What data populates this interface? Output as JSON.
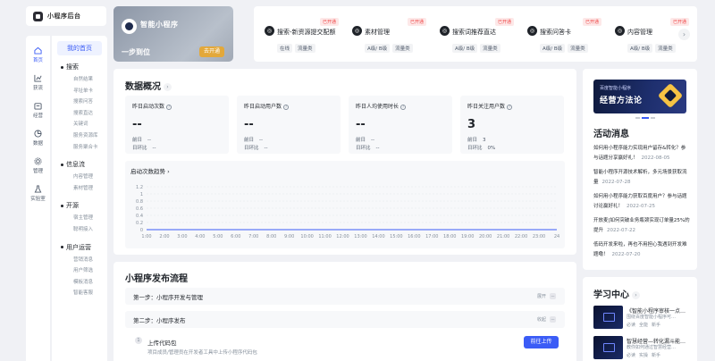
{
  "brand": {
    "name": "小程序后台"
  },
  "rail": [
    {
      "label": "首页",
      "icon": "home-icon",
      "active": true
    },
    {
      "label": "获流",
      "icon": "chart-icon"
    },
    {
      "label": "经营",
      "icon": "wallet-icon"
    },
    {
      "label": "数据",
      "icon": "pie-icon"
    },
    {
      "label": "管理",
      "icon": "gear-icon"
    },
    {
      "label": "实验室",
      "icon": "flask-icon"
    }
  ],
  "subnav": {
    "home": "我的首页",
    "groups": [
      {
        "title": "搜索",
        "items": [
          "自然结果",
          "寻址单卡",
          "搜索问答",
          "搜索直达",
          "关键词",
          "服务资源库",
          "服务聚合卡"
        ]
      },
      {
        "title": "信息流",
        "items": [
          "内容管理",
          "素材管理"
        ]
      },
      {
        "title": "开源",
        "items": [
          "宿主管理",
          "聪明接入"
        ]
      },
      {
        "title": "用户运营",
        "items": [
          "营销消息",
          "用户筛选",
          "模板消息",
          "智能客服"
        ]
      }
    ]
  },
  "profile": {
    "name": "智能小程序",
    "subtitle": "一步到位",
    "badge": "去开通"
  },
  "tools": [
    {
      "title": "搜索-新资源提交配额",
      "tags": [
        "在线",
        "流量类"
      ],
      "status": "已开通"
    },
    {
      "title": "素材管理",
      "tags": [
        "A级/ B级",
        "流量类"
      ],
      "status": "已开通"
    },
    {
      "title": "搜索词推荐直达",
      "tags": [
        "A级/ B级",
        "流量类"
      ],
      "status": "已开通"
    },
    {
      "title": "搜索问答卡",
      "tags": [
        "A级/ B级",
        "流量类"
      ],
      "status": "已开通"
    },
    {
      "title": "内容管理",
      "tags": [
        "A级/ B级",
        "流量类"
      ],
      "status": "已开通"
    }
  ],
  "overview": {
    "title": "数据概况",
    "metrics": [
      {
        "label": "昨日启动次数",
        "value": "--",
        "prev_label": "前日",
        "prev": "--",
        "ratio_label": "日环比",
        "ratio": "--"
      },
      {
        "label": "昨日启动用户数",
        "value": "--",
        "prev_label": "前日",
        "prev": "--",
        "ratio_label": "日环比",
        "ratio": "--"
      },
      {
        "label": "昨日人均使用时长",
        "value": "--",
        "prev_label": "前日",
        "prev": "--",
        "ratio_label": "日环比",
        "ratio": "--"
      },
      {
        "label": "昨日关注用户数",
        "value": "3",
        "prev_label": "前日",
        "prev": "3",
        "ratio_label": "日环比",
        "ratio": "0%"
      }
    ],
    "trend_title": "启动次数趋势"
  },
  "chart_data": {
    "type": "line",
    "x": [
      "1:00",
      "2:00",
      "3:00",
      "4:00",
      "5:00",
      "6:00",
      "7:00",
      "8:00",
      "9:00",
      "10:00",
      "11:00",
      "12:00",
      "13:00",
      "14:00",
      "15:00",
      "16:00",
      "17:00",
      "18:00",
      "19:00",
      "20:00",
      "21:00",
      "22:00",
      "23:00",
      "24"
    ],
    "series": [
      {
        "values": [
          0,
          0,
          0,
          0,
          0,
          0,
          0,
          0,
          0,
          0,
          0,
          0,
          0,
          0,
          0,
          0,
          0,
          0,
          0,
          0,
          0,
          0,
          0,
          0
        ]
      }
    ],
    "yticks": [
      "0",
      "0.2",
      "0.4",
      "0.6",
      "0.8",
      "1",
      "1.2"
    ],
    "ylim": [
      0,
      1.2
    ],
    "title": "启动次数趋势",
    "grid": true,
    "line_color": "#3b5cf6"
  },
  "flow": {
    "title": "小程序发布流程",
    "steps": [
      {
        "title": "第一步：小程序开发与管理",
        "toggle": "展开"
      },
      {
        "title": "第二步：小程序发布",
        "toggle": "收起"
      }
    ],
    "upload": {
      "index": "1",
      "title": "上传代码包",
      "desc": "项目成员/管理员在开发者工具中上传小程序代码包",
      "button": "前往上传"
    }
  },
  "news": {
    "banner_small": "百度智能小程序",
    "banner_large": "经营方法论",
    "title": "活动消息",
    "items": [
      {
        "text": "如何用小程序能力实现用户留存&转化？参与话题分享赢好礼！",
        "date": "2022-08-05"
      },
      {
        "text": "智能小程序开源技术解析，多元场景获取流量",
        "date": "2022-07-28"
      },
      {
        "text": "如何用小程序能力获取百度用户？参与话题讨论赢好礼！",
        "date": "2022-07-25"
      },
      {
        "text": "开放麦|如何突破业务瓶颈实现订单量25%的提升",
        "date": "2022-07-22"
      },
      {
        "text": "低码开发来啦，再也不用担心我遇到开发难题嘞！",
        "date": "2022-07-20"
      }
    ]
  },
  "learn": {
    "title": "学习中心",
    "courses": [
      {
        "title": "《智能小程序审核一点…",
        "sub": "围绕百度智能小程序可…",
        "tags": [
          "必读",
          "全能",
          "新手"
        ]
      },
      {
        "title": "智慧经营—转化漏斗能…",
        "sub": "教你如何通过智慧经营…",
        "tags": [
          "必读",
          "实操",
          "新手"
        ]
      }
    ]
  }
}
